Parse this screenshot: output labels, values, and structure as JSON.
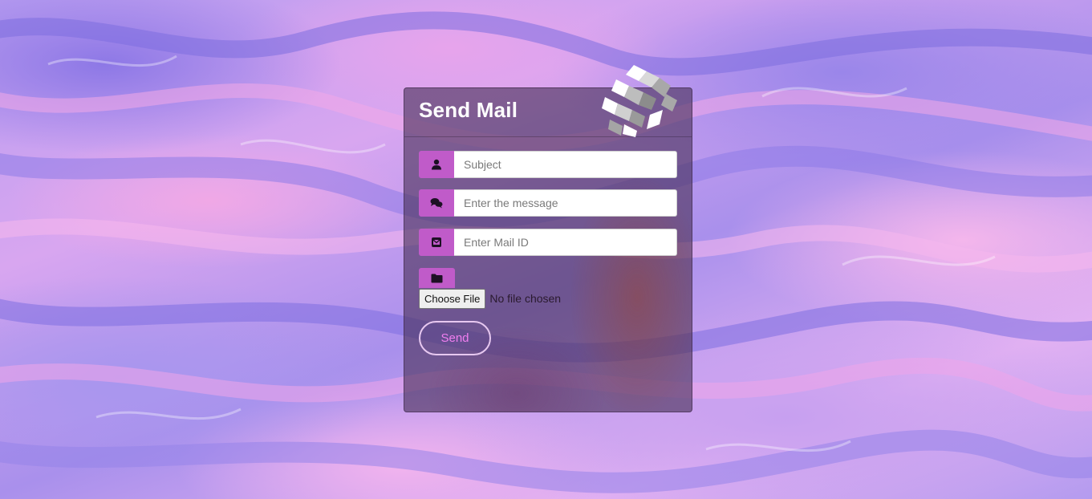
{
  "form": {
    "title": "Send Mail",
    "subject": {
      "icon": "user-icon",
      "placeholder": "Subject",
      "value": ""
    },
    "message": {
      "icon": "comments-icon",
      "placeholder": "Enter the message",
      "value": ""
    },
    "mail_id": {
      "icon": "envelope-icon",
      "placeholder": "Enter Mail ID",
      "value": ""
    },
    "attachment": {
      "icon": "folder-icon",
      "button_label": "Choose File",
      "status": "No file chosen"
    },
    "send_label": "Send"
  },
  "colors": {
    "accent": "#c05bc9",
    "send_text": "#f07ef0",
    "card_bg": "#483058"
  }
}
